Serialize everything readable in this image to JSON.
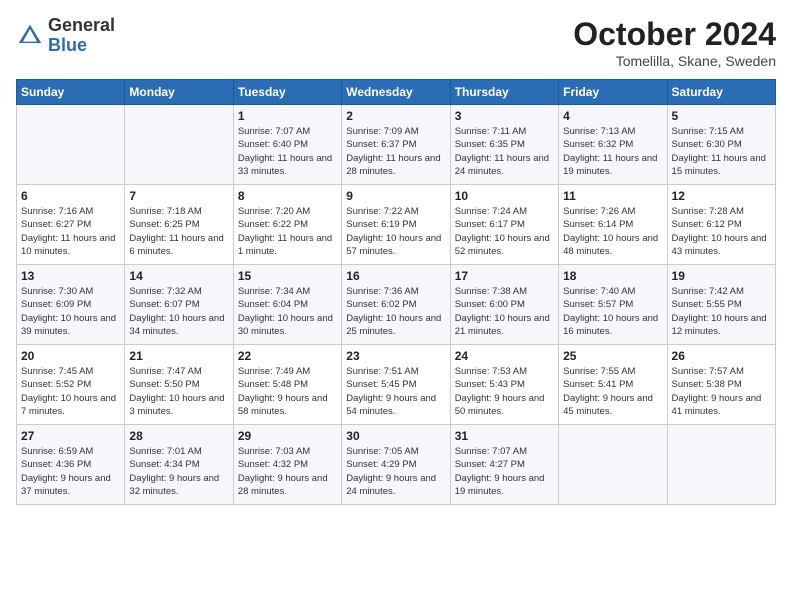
{
  "header": {
    "logo_line1": "General",
    "logo_line2": "Blue",
    "month": "October 2024",
    "location": "Tomelilla, Skane, Sweden"
  },
  "days_of_week": [
    "Sunday",
    "Monday",
    "Tuesday",
    "Wednesday",
    "Thursday",
    "Friday",
    "Saturday"
  ],
  "weeks": [
    [
      {
        "day": "",
        "sunrise": "",
        "sunset": "",
        "daylight": ""
      },
      {
        "day": "",
        "sunrise": "",
        "sunset": "",
        "daylight": ""
      },
      {
        "day": "1",
        "sunrise": "Sunrise: 7:07 AM",
        "sunset": "Sunset: 6:40 PM",
        "daylight": "Daylight: 11 hours and 33 minutes."
      },
      {
        "day": "2",
        "sunrise": "Sunrise: 7:09 AM",
        "sunset": "Sunset: 6:37 PM",
        "daylight": "Daylight: 11 hours and 28 minutes."
      },
      {
        "day": "3",
        "sunrise": "Sunrise: 7:11 AM",
        "sunset": "Sunset: 6:35 PM",
        "daylight": "Daylight: 11 hours and 24 minutes."
      },
      {
        "day": "4",
        "sunrise": "Sunrise: 7:13 AM",
        "sunset": "Sunset: 6:32 PM",
        "daylight": "Daylight: 11 hours and 19 minutes."
      },
      {
        "day": "5",
        "sunrise": "Sunrise: 7:15 AM",
        "sunset": "Sunset: 6:30 PM",
        "daylight": "Daylight: 11 hours and 15 minutes."
      }
    ],
    [
      {
        "day": "6",
        "sunrise": "Sunrise: 7:16 AM",
        "sunset": "Sunset: 6:27 PM",
        "daylight": "Daylight: 11 hours and 10 minutes."
      },
      {
        "day": "7",
        "sunrise": "Sunrise: 7:18 AM",
        "sunset": "Sunset: 6:25 PM",
        "daylight": "Daylight: 11 hours and 6 minutes."
      },
      {
        "day": "8",
        "sunrise": "Sunrise: 7:20 AM",
        "sunset": "Sunset: 6:22 PM",
        "daylight": "Daylight: 11 hours and 1 minute."
      },
      {
        "day": "9",
        "sunrise": "Sunrise: 7:22 AM",
        "sunset": "Sunset: 6:19 PM",
        "daylight": "Daylight: 10 hours and 57 minutes."
      },
      {
        "day": "10",
        "sunrise": "Sunrise: 7:24 AM",
        "sunset": "Sunset: 6:17 PM",
        "daylight": "Daylight: 10 hours and 52 minutes."
      },
      {
        "day": "11",
        "sunrise": "Sunrise: 7:26 AM",
        "sunset": "Sunset: 6:14 PM",
        "daylight": "Daylight: 10 hours and 48 minutes."
      },
      {
        "day": "12",
        "sunrise": "Sunrise: 7:28 AM",
        "sunset": "Sunset: 6:12 PM",
        "daylight": "Daylight: 10 hours and 43 minutes."
      }
    ],
    [
      {
        "day": "13",
        "sunrise": "Sunrise: 7:30 AM",
        "sunset": "Sunset: 6:09 PM",
        "daylight": "Daylight: 10 hours and 39 minutes."
      },
      {
        "day": "14",
        "sunrise": "Sunrise: 7:32 AM",
        "sunset": "Sunset: 6:07 PM",
        "daylight": "Daylight: 10 hours and 34 minutes."
      },
      {
        "day": "15",
        "sunrise": "Sunrise: 7:34 AM",
        "sunset": "Sunset: 6:04 PM",
        "daylight": "Daylight: 10 hours and 30 minutes."
      },
      {
        "day": "16",
        "sunrise": "Sunrise: 7:36 AM",
        "sunset": "Sunset: 6:02 PM",
        "daylight": "Daylight: 10 hours and 25 minutes."
      },
      {
        "day": "17",
        "sunrise": "Sunrise: 7:38 AM",
        "sunset": "Sunset: 6:00 PM",
        "daylight": "Daylight: 10 hours and 21 minutes."
      },
      {
        "day": "18",
        "sunrise": "Sunrise: 7:40 AM",
        "sunset": "Sunset: 5:57 PM",
        "daylight": "Daylight: 10 hours and 16 minutes."
      },
      {
        "day": "19",
        "sunrise": "Sunrise: 7:42 AM",
        "sunset": "Sunset: 5:55 PM",
        "daylight": "Daylight: 10 hours and 12 minutes."
      }
    ],
    [
      {
        "day": "20",
        "sunrise": "Sunrise: 7:45 AM",
        "sunset": "Sunset: 5:52 PM",
        "daylight": "Daylight: 10 hours and 7 minutes."
      },
      {
        "day": "21",
        "sunrise": "Sunrise: 7:47 AM",
        "sunset": "Sunset: 5:50 PM",
        "daylight": "Daylight: 10 hours and 3 minutes."
      },
      {
        "day": "22",
        "sunrise": "Sunrise: 7:49 AM",
        "sunset": "Sunset: 5:48 PM",
        "daylight": "Daylight: 9 hours and 58 minutes."
      },
      {
        "day": "23",
        "sunrise": "Sunrise: 7:51 AM",
        "sunset": "Sunset: 5:45 PM",
        "daylight": "Daylight: 9 hours and 54 minutes."
      },
      {
        "day": "24",
        "sunrise": "Sunrise: 7:53 AM",
        "sunset": "Sunset: 5:43 PM",
        "daylight": "Daylight: 9 hours and 50 minutes."
      },
      {
        "day": "25",
        "sunrise": "Sunrise: 7:55 AM",
        "sunset": "Sunset: 5:41 PM",
        "daylight": "Daylight: 9 hours and 45 minutes."
      },
      {
        "day": "26",
        "sunrise": "Sunrise: 7:57 AM",
        "sunset": "Sunset: 5:38 PM",
        "daylight": "Daylight: 9 hours and 41 minutes."
      }
    ],
    [
      {
        "day": "27",
        "sunrise": "Sunrise: 6:59 AM",
        "sunset": "Sunset: 4:36 PM",
        "daylight": "Daylight: 9 hours and 37 minutes."
      },
      {
        "day": "28",
        "sunrise": "Sunrise: 7:01 AM",
        "sunset": "Sunset: 4:34 PM",
        "daylight": "Daylight: 9 hours and 32 minutes."
      },
      {
        "day": "29",
        "sunrise": "Sunrise: 7:03 AM",
        "sunset": "Sunset: 4:32 PM",
        "daylight": "Daylight: 9 hours and 28 minutes."
      },
      {
        "day": "30",
        "sunrise": "Sunrise: 7:05 AM",
        "sunset": "Sunset: 4:29 PM",
        "daylight": "Daylight: 9 hours and 24 minutes."
      },
      {
        "day": "31",
        "sunrise": "Sunrise: 7:07 AM",
        "sunset": "Sunset: 4:27 PM",
        "daylight": "Daylight: 9 hours and 19 minutes."
      },
      {
        "day": "",
        "sunrise": "",
        "sunset": "",
        "daylight": ""
      },
      {
        "day": "",
        "sunrise": "",
        "sunset": "",
        "daylight": ""
      }
    ]
  ]
}
